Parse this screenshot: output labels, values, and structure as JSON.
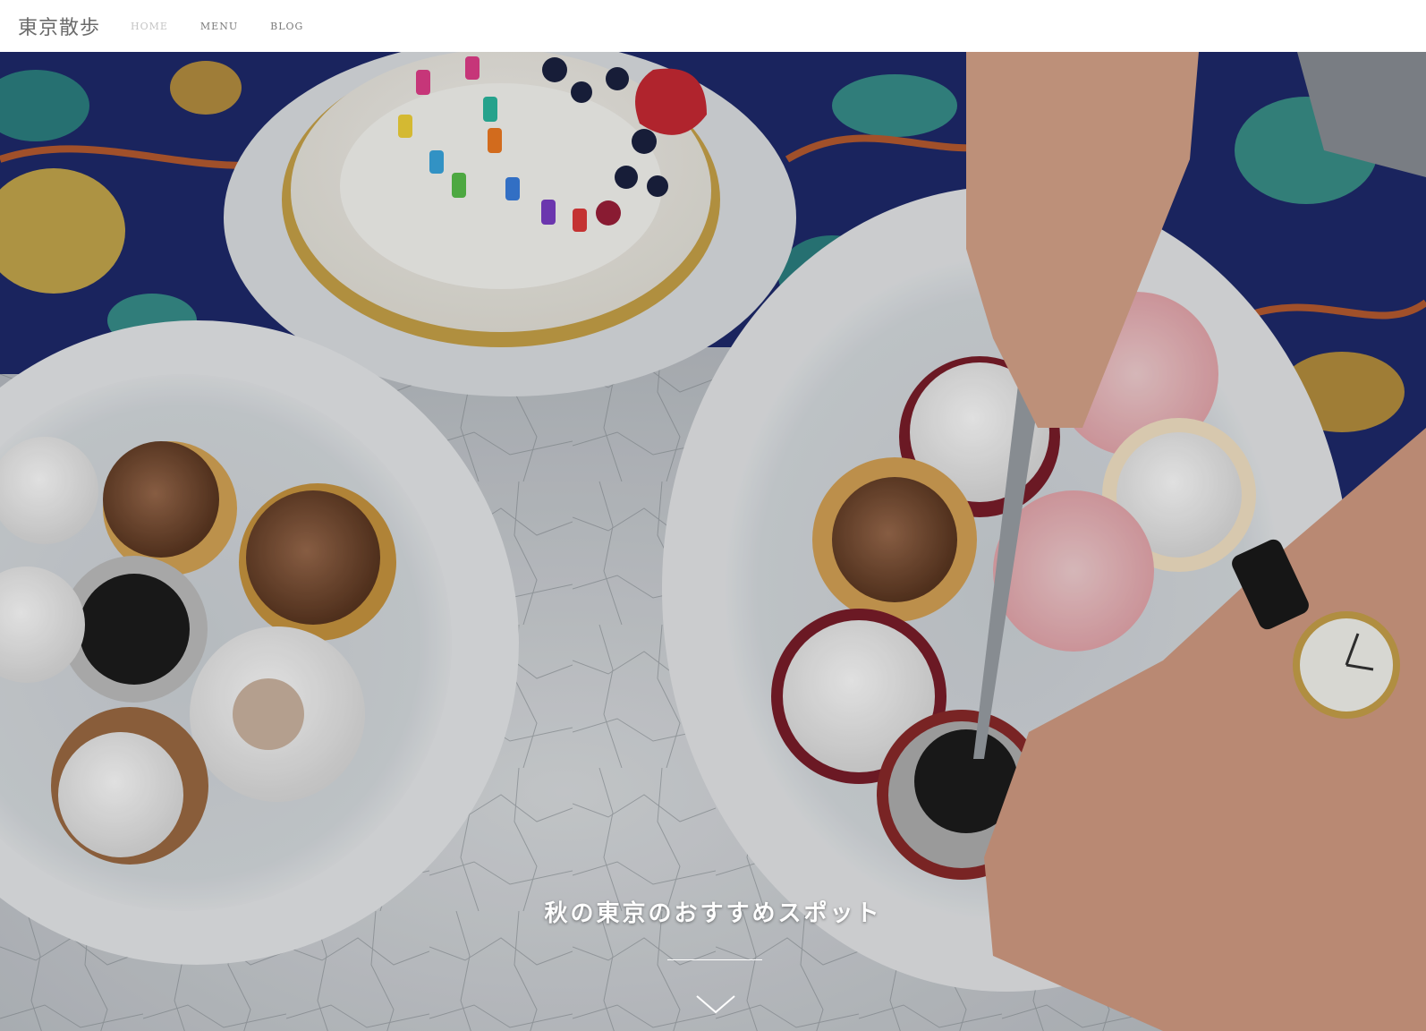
{
  "header": {
    "logo": "東京散歩",
    "nav": [
      {
        "label": "HOME",
        "active": true
      },
      {
        "label": "MENU",
        "active": false
      },
      {
        "label": "BLOG",
        "active": false
      }
    ]
  },
  "hero": {
    "image": "cupcakes-and-cake-photo",
    "tagline": "秋の東京のおすすめスポット",
    "scroll_icon": "chevron-down-icon"
  },
  "colors": {
    "header_bg": "#ffffff",
    "logo_text": "#6b6b6b",
    "nav_text": "#7a7a7a",
    "nav_active": "#c4c4c4",
    "tagline_text": "#ffffff"
  }
}
